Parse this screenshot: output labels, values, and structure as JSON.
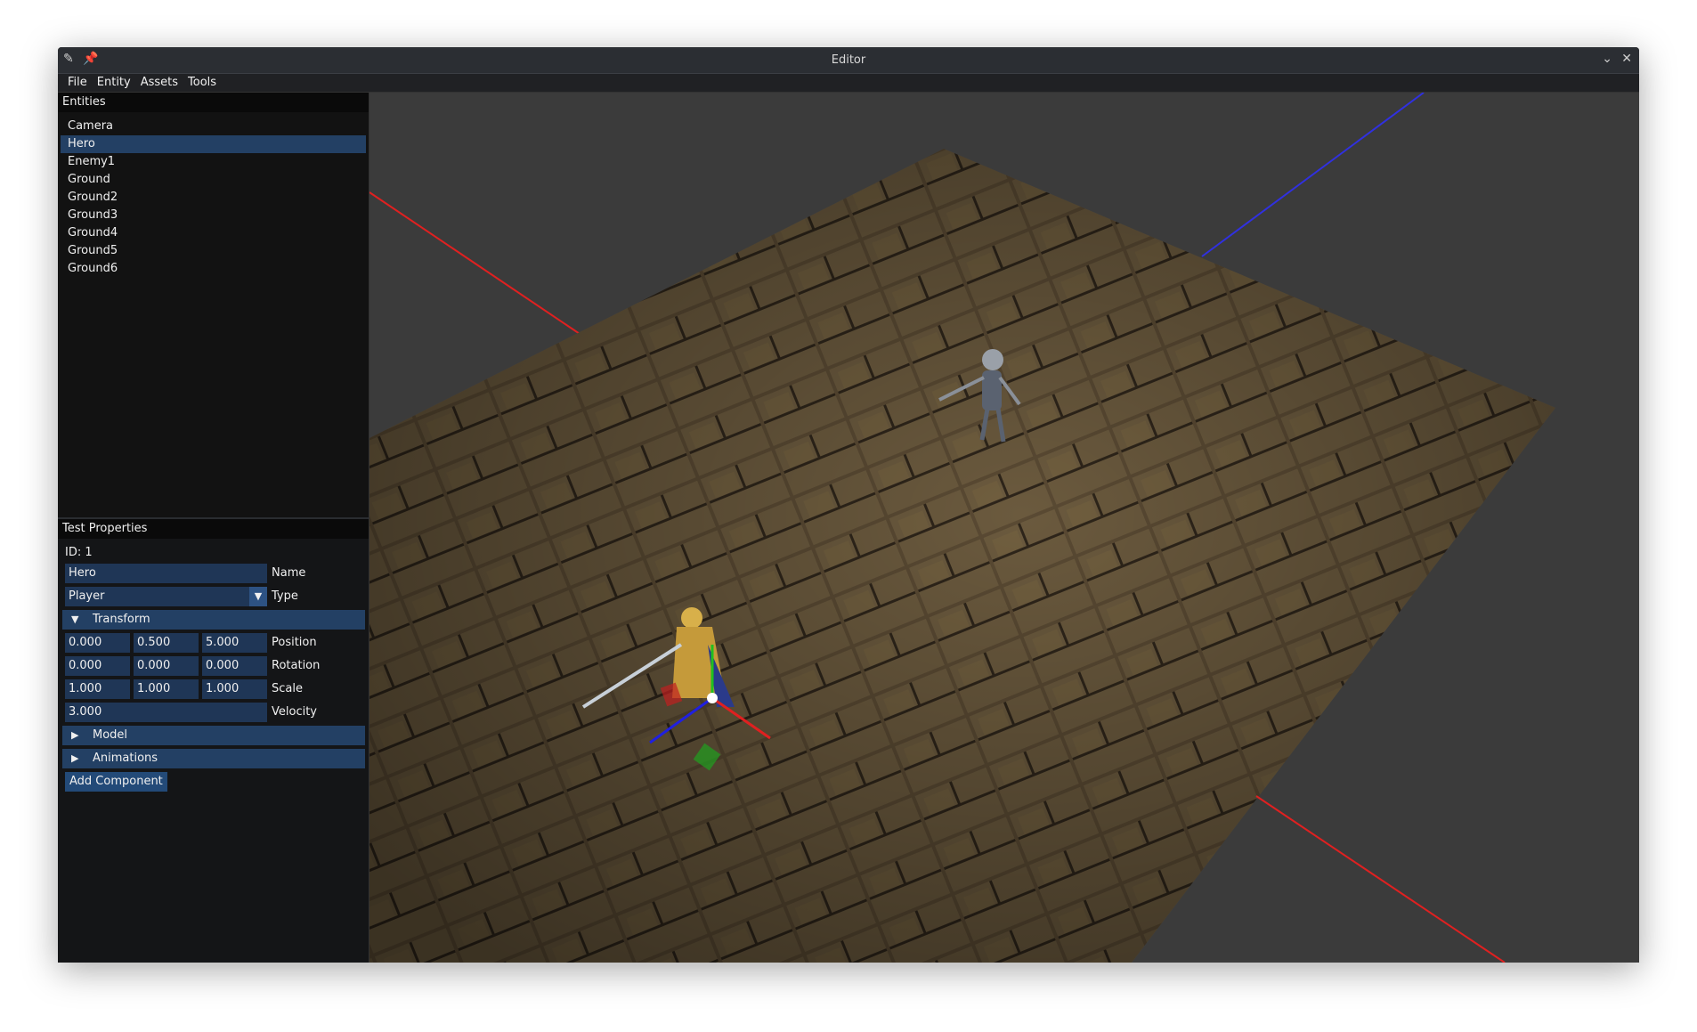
{
  "window": {
    "title": "Editor"
  },
  "menu": [
    "File",
    "Entity",
    "Assets",
    "Tools"
  ],
  "entities": {
    "title": "Entities",
    "items": [
      "Camera",
      "Hero",
      "Enemy1",
      "Ground",
      "Ground2",
      "Ground3",
      "Ground4",
      "Ground5",
      "Ground6"
    ],
    "selected": "Hero"
  },
  "properties": {
    "title": "Test Properties",
    "id_label": "ID: 1",
    "name_value": "Hero",
    "name_label": "Name",
    "type_value": "Player",
    "type_label": "Type",
    "transform_label": "Transform",
    "position": [
      "0.000",
      "0.500",
      "5.000"
    ],
    "position_label": "Position",
    "rotation": [
      "0.000",
      "0.000",
      "0.000"
    ],
    "rotation_label": "Rotation",
    "scale": [
      "1.000",
      "1.000",
      "1.000"
    ],
    "scale_label": "Scale",
    "velocity": "3.000",
    "velocity_label": "Velocity",
    "model_label": "Model",
    "animations_label": "Animations",
    "add_component": "Add Component"
  },
  "colors": {
    "selection": "#234064",
    "field": "#1f3656",
    "axis_x": "#e02020",
    "axis_z": "#3030e0"
  }
}
